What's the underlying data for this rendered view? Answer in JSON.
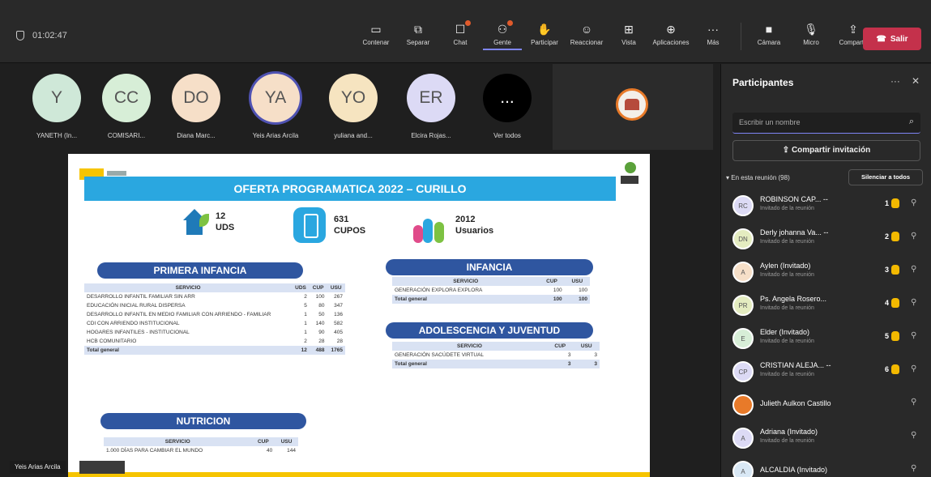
{
  "meeting": {
    "timer": "01:02:47",
    "toolbar": [
      {
        "label": "Contenar",
        "icon": "monitor-icon"
      },
      {
        "label": "Separar",
        "icon": "split-icon"
      },
      {
        "label": "Chat",
        "icon": "chat-icon"
      },
      {
        "label": "Gente",
        "icon": "people-icon"
      },
      {
        "label": "Participar",
        "icon": "hand-icon"
      },
      {
        "label": "Reaccionar",
        "icon": "emoji-icon"
      },
      {
        "label": "Vista",
        "icon": "grid-icon"
      },
      {
        "label": "Aplicaciones",
        "icon": "apps-icon"
      },
      {
        "label": "Más",
        "icon": "more-icon"
      }
    ],
    "devices": [
      {
        "label": "Cámara",
        "icon": "camera-icon"
      },
      {
        "label": "Micro",
        "icon": "mic-icon"
      },
      {
        "label": "Compartir",
        "icon": "share-icon"
      }
    ],
    "leave_label": "Salir",
    "accent_color": "#7f85f5",
    "leave_color": "#c4314b"
  },
  "gallery": [
    {
      "initials": "Y",
      "name": "YANETH (In...",
      "color": "#cfe8d8"
    },
    {
      "initials": "CC",
      "name": "COMISARI...",
      "color": "#d7eed7"
    },
    {
      "initials": "DO",
      "name": "Diana Marc...",
      "color": "#f6dfc8"
    },
    {
      "initials": "YA",
      "name": "Yeis Arias Arcila",
      "color": "#f6dfc8"
    },
    {
      "initials": "YO",
      "name": "yuliana and...",
      "color": "#f6e4c0"
    },
    {
      "initials": "ER",
      "name": "Elcira Rojas...",
      "color": "#dcdaf5"
    },
    {
      "initials": "...",
      "name": "Ver todos",
      "color": "#000000"
    }
  ],
  "slide": {
    "title": "OFERTA PROGRAMATICA 2022 – CURILLO",
    "stats": [
      {
        "num": "12",
        "label": "UDS"
      },
      {
        "num": "631",
        "label": "CUPOS"
      },
      {
        "num": "2012",
        "label": "Usuarios"
      }
    ],
    "primera": {
      "title": "PRIMERA INFANCIA",
      "headers": [
        "SERVICIO",
        "UDS",
        "CUP",
        "USU"
      ],
      "rows": [
        [
          "DESARROLLO INFANTIL FAMILIAR SIN ARR",
          "2",
          "100",
          "267"
        ],
        [
          "EDUCACIÓN INICIAL RURAL DISPERSA",
          "5",
          "80",
          "347"
        ],
        [
          "DESARROLLO INFANTIL EN MEDIO FAMILIAR CON ARRIENDO - FAMILIAR",
          "1",
          "50",
          "136"
        ],
        [
          "CDI CON ARRIENDO INSTITUCIONAL",
          "1",
          "140",
          "582"
        ],
        [
          "HOGARES INFANTILES - INSTITUCIONAL",
          "1",
          "90",
          "405"
        ],
        [
          "HCB COMUNITARIO",
          "2",
          "28",
          "28"
        ]
      ],
      "total": [
        "Total general",
        "12",
        "488",
        "1765"
      ]
    },
    "infancia": {
      "title": "INFANCIA",
      "headers": [
        "SERVICIO",
        "CUP",
        "USU"
      ],
      "rows": [
        [
          "GENERACIÓN EXPLORA EXPLORA",
          "100",
          "100"
        ]
      ],
      "total": [
        "Total general",
        "100",
        "100"
      ]
    },
    "adolescencia": {
      "title": "ADOLESCENCIA Y JUVENTUD",
      "headers": [
        "SERVICIO",
        "CUP",
        "USU"
      ],
      "rows": [
        [
          "GENERACIÓN SACÚDETE VIRTUAL",
          "3",
          "3"
        ]
      ],
      "total": [
        "Total general",
        "3",
        "3"
      ]
    },
    "nutricion": {
      "title": "NUTRICION",
      "headers": [
        "SERVICIO",
        "CUP",
        "USU"
      ],
      "rows": [
        [
          "1.000 DÍAS PARA CAMBIAR EL MUNDO",
          "40",
          "144"
        ]
      ]
    }
  },
  "presenter_name": "Yeis Arias Arcila",
  "panel": {
    "title": "Participantes",
    "search_placeholder": "Escribir un nombre",
    "share_label": "Compartir invitación",
    "section_label": "En esta reunión (98)",
    "mute_all_label": "Silenciar a todos",
    "participants": [
      {
        "initials": "RC",
        "name": "ROBINSON CAP... --",
        "sub": "Invitado de la reunión",
        "hand": "1",
        "color": "#dcdaf5"
      },
      {
        "initials": "DN",
        "name": "Derly johanna Va... --",
        "sub": "Invitado de la reunión",
        "hand": "2",
        "color": "#e4ecc0"
      },
      {
        "initials": "A",
        "name": "Aylen (Invitado)",
        "sub": "Invitado de la reunión",
        "hand": "3",
        "color": "#f6dfc8"
      },
      {
        "initials": "PR",
        "name": "Ps. Angela Rosero...",
        "sub": "Invitado de la reunión",
        "hand": "4",
        "color": "#e4ecc0"
      },
      {
        "initials": "E",
        "name": "Elder (Invitado)",
        "sub": "Invitado de la reunión",
        "hand": "5",
        "color": "#d7eed7"
      },
      {
        "initials": "CP",
        "name": "CRISTIAN ALEJA... --",
        "sub": "Invitado de la reunión",
        "hand": "6",
        "color": "#dcdaf5"
      },
      {
        "initials": "",
        "name": "Julieth Aulkon Castillo",
        "sub": "",
        "hand": "",
        "color": "#e87a29"
      },
      {
        "initials": "A",
        "name": "Adriana (Invitado)",
        "sub": "Invitado de la reunión",
        "hand": "",
        "color": "#dcdaf5"
      },
      {
        "initials": "A",
        "name": "ALCALDIA (Invitado)",
        "sub": "",
        "hand": "",
        "color": "#d9e8f5"
      }
    ]
  }
}
